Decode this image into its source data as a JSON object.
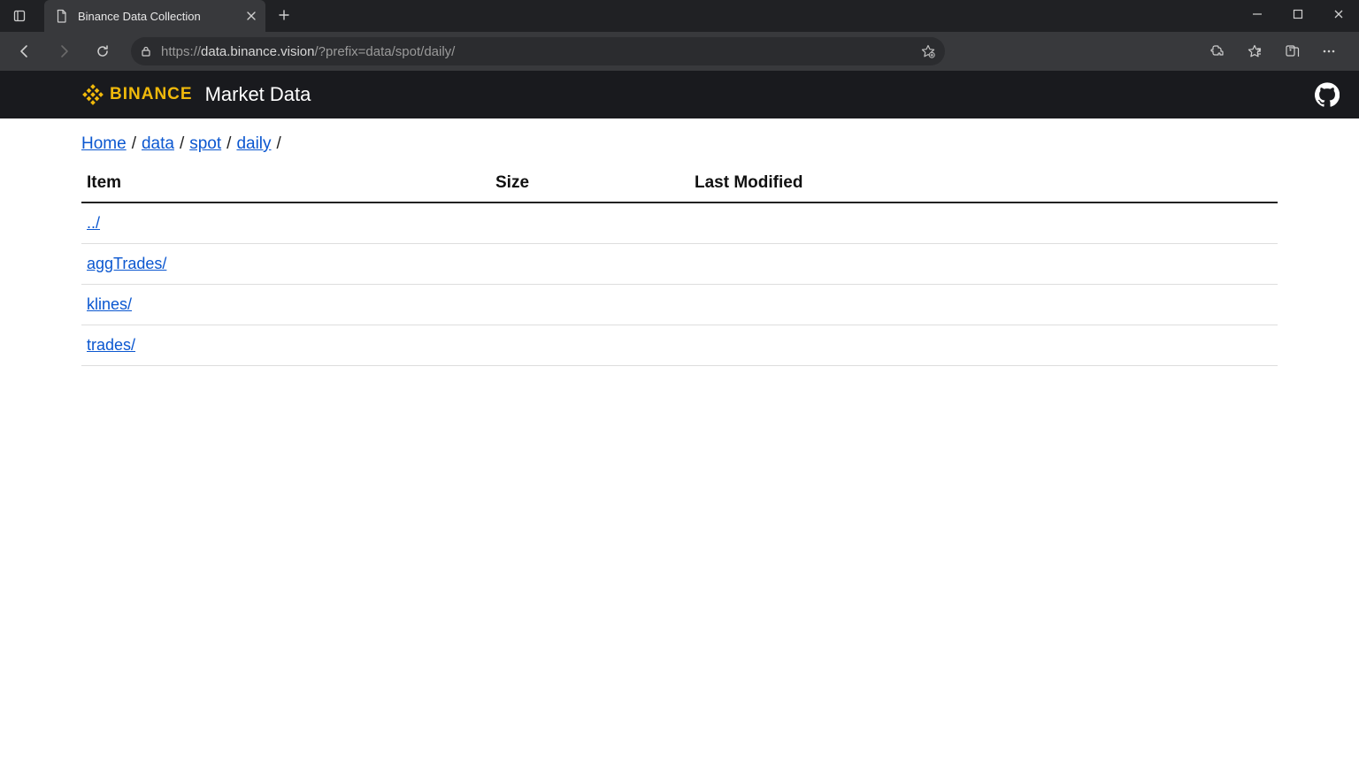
{
  "browser": {
    "tab_title": "Binance Data Collection",
    "url_scheme": "https",
    "url_host": "data.binance.vision",
    "url_path": "/?prefix=data/spot/daily/"
  },
  "header": {
    "logo_text": "BINANCE",
    "title": "Market Data"
  },
  "breadcrumb": [
    {
      "label": "Home",
      "link": true
    },
    {
      "label": "data",
      "link": true
    },
    {
      "label": "spot",
      "link": true
    },
    {
      "label": "daily",
      "link": true
    }
  ],
  "listing": {
    "columns": {
      "item": "Item",
      "size": "Size",
      "modified": "Last Modified"
    },
    "rows": [
      {
        "name": "../",
        "size": "",
        "modified": ""
      },
      {
        "name": "aggTrades/",
        "size": "",
        "modified": ""
      },
      {
        "name": "klines/",
        "size": "",
        "modified": ""
      },
      {
        "name": "trades/",
        "size": "",
        "modified": ""
      }
    ]
  }
}
